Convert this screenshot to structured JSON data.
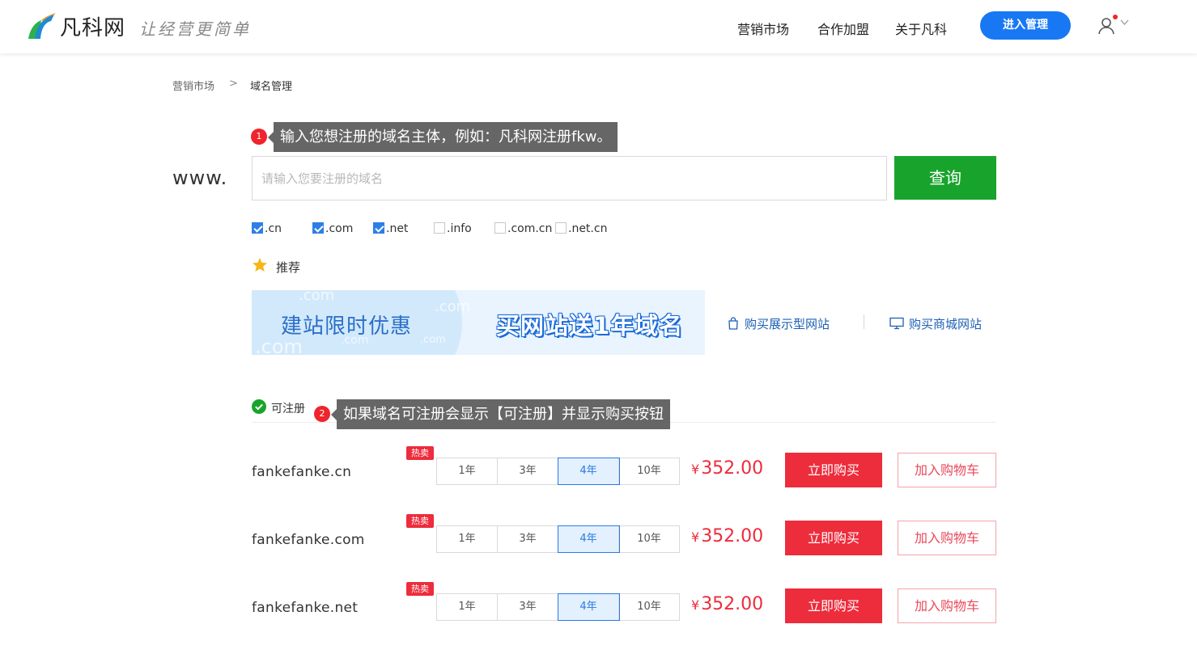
{
  "header": {
    "logo_text": "凡科网",
    "slogan": "让经营更简单",
    "nav": [
      "营销市场",
      "合作加盟",
      "关于凡科"
    ],
    "enter_label": "进入管理"
  },
  "breadcrumb": {
    "parent": "营销市场",
    "separator": ">",
    "current": "域名管理"
  },
  "tips": {
    "tip1_num": "1",
    "tip1_text": "输入您想注册的域名主体，例如：凡科网注册fkw。",
    "tip2_num": "2",
    "tip2_text": "如果域名可注册会显示【可注册】并显示购买按钮"
  },
  "search": {
    "prefix": "www.",
    "placeholder": "请输入您要注册的域名",
    "value": "",
    "button_label": "查询"
  },
  "suffixes": [
    {
      "label": ".cn",
      "checked": true
    },
    {
      "label": ".com",
      "checked": true
    },
    {
      "label": ".net",
      "checked": true
    },
    {
      "label": ".info",
      "checked": false
    },
    {
      "label": ".com.cn",
      "checked": false
    },
    {
      "label": ".net.cn",
      "checked": false
    }
  ],
  "recommend": {
    "label": "推荐",
    "banner_title": "建站限时优惠",
    "banner_promo": "买网站送1年域名",
    "banner_ghost_text": ".com",
    "link_1": "购买展示型网站",
    "link_2": "购买商城网站"
  },
  "results": {
    "status_label": "可注册",
    "hot_label": "热卖",
    "currency": "¥",
    "buy_label": "立即购买",
    "cart_label": "加入购物车",
    "years": [
      "1年",
      "3年",
      "4年",
      "10年"
    ],
    "selected_year_index": 2,
    "rows": [
      {
        "domain": "fankefanke.cn",
        "price": "352.00"
      },
      {
        "domain": "fankefanke.com",
        "price": "352.00"
      },
      {
        "domain": "fankefanke.net",
        "price": "352.00"
      }
    ]
  },
  "colors": {
    "brand_blue": "#1878f3",
    "search_green": "#18a42c",
    "price_red": "#ed2c3c",
    "checkbox_blue": "#2d7fe6"
  }
}
